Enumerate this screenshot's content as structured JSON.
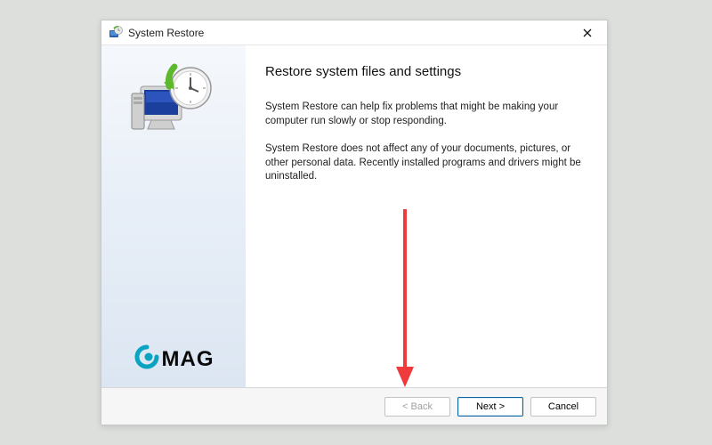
{
  "titlebar": {
    "title": "System Restore"
  },
  "main": {
    "heading": "Restore system files and settings",
    "paragraph1": "System Restore can help fix problems that might be making your computer run slowly or stop responding.",
    "paragraph2": "System Restore does not affect any of your documents, pictures, or other personal data. Recently installed programs and drivers might be uninstalled."
  },
  "logo": {
    "text": "MAG"
  },
  "footer": {
    "back_label": "< Back",
    "next_label": "Next >",
    "cancel_label": "Cancel"
  }
}
